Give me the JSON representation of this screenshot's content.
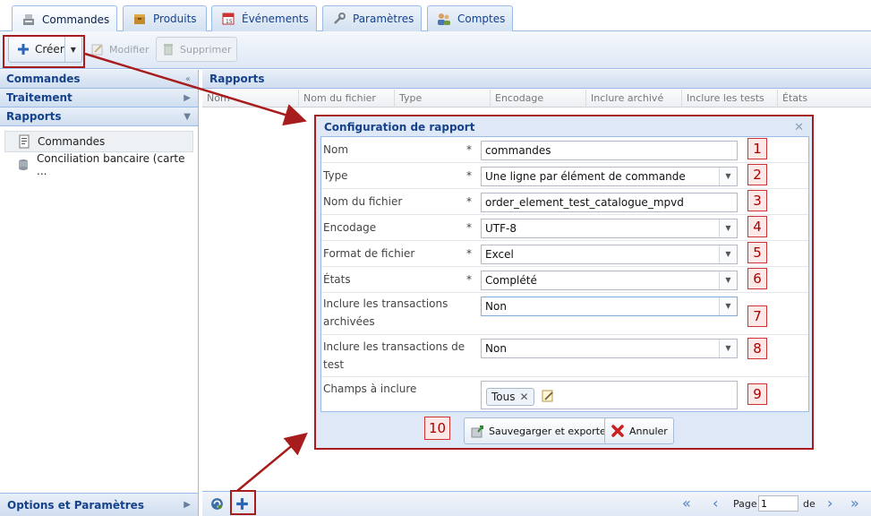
{
  "tabs": [
    {
      "label": "Commandes",
      "icon": "cash-register-icon",
      "active": true
    },
    {
      "label": "Produits",
      "icon": "box-icon",
      "active": false
    },
    {
      "label": "Événements",
      "icon": "calendar-icon",
      "active": false
    },
    {
      "label": "Paramètres",
      "icon": "wrench-icon",
      "active": false
    },
    {
      "label": "Comptes",
      "icon": "users-icon",
      "active": false
    }
  ],
  "toolbar": {
    "create_label": "Créer",
    "edit_label": "Modifier",
    "delete_label": "Supprimer"
  },
  "sidebar": {
    "sections": [
      {
        "label": "Commandes",
        "caret": "«"
      },
      {
        "label": "Traitement",
        "caret": "▶"
      },
      {
        "label": "Rapports",
        "caret": "▼"
      }
    ],
    "items": [
      {
        "label": "Commandes",
        "icon": "report-icon",
        "selected": true
      },
      {
        "label": "Conciliation bancaire (carte ...",
        "icon": "database-icon",
        "selected": false
      }
    ],
    "footer": {
      "label": "Options et Paramètres",
      "caret": "▶"
    }
  },
  "grid": {
    "title": "Rapports",
    "columns": [
      "Nom",
      "Nom du fichier",
      "Type",
      "Encodage",
      "Inclure archivé",
      "Inclure les tests",
      "États"
    ]
  },
  "pager": {
    "page_label": "Page",
    "page_value": "1",
    "of_label": "de"
  },
  "dialog": {
    "title": "Configuration de rapport",
    "fields": [
      {
        "label": "Nom",
        "required": "*",
        "value": "commandes",
        "kind": "text",
        "num": "1"
      },
      {
        "label": "Type",
        "required": "*",
        "value": "Une ligne par élément de commande",
        "kind": "combo",
        "num": "2"
      },
      {
        "label": "Nom du fichier",
        "required": "*",
        "value": "order_element_test_catalogue_mpvd",
        "kind": "text",
        "num": "3"
      },
      {
        "label": "Encodage",
        "required": "*",
        "value": "UTF-8",
        "kind": "combo",
        "num": "4"
      },
      {
        "label": "Format de fichier",
        "required": "*",
        "value": "Excel",
        "kind": "combo",
        "num": "5"
      },
      {
        "label": "États",
        "required": "*",
        "value": "Complété",
        "kind": "combo",
        "num": "6"
      },
      {
        "label": "Inclure les transactions archivées",
        "required": "",
        "value": "Non",
        "kind": "combo",
        "num": "7"
      },
      {
        "label": "Inclure les transactions de test",
        "required": "",
        "value": "Non",
        "kind": "combo",
        "num": "8"
      },
      {
        "label": "Champs à inclure",
        "required": "",
        "value": "Tous",
        "kind": "tags",
        "num": "9"
      }
    ],
    "footer_num": "10",
    "save_label": "Sauvegarger et exporter",
    "cancel_label": "Annuler"
  },
  "colors": {
    "annotation": "#a71c1c",
    "panel_border": "#99bbe8",
    "header_text": "#15428b"
  }
}
